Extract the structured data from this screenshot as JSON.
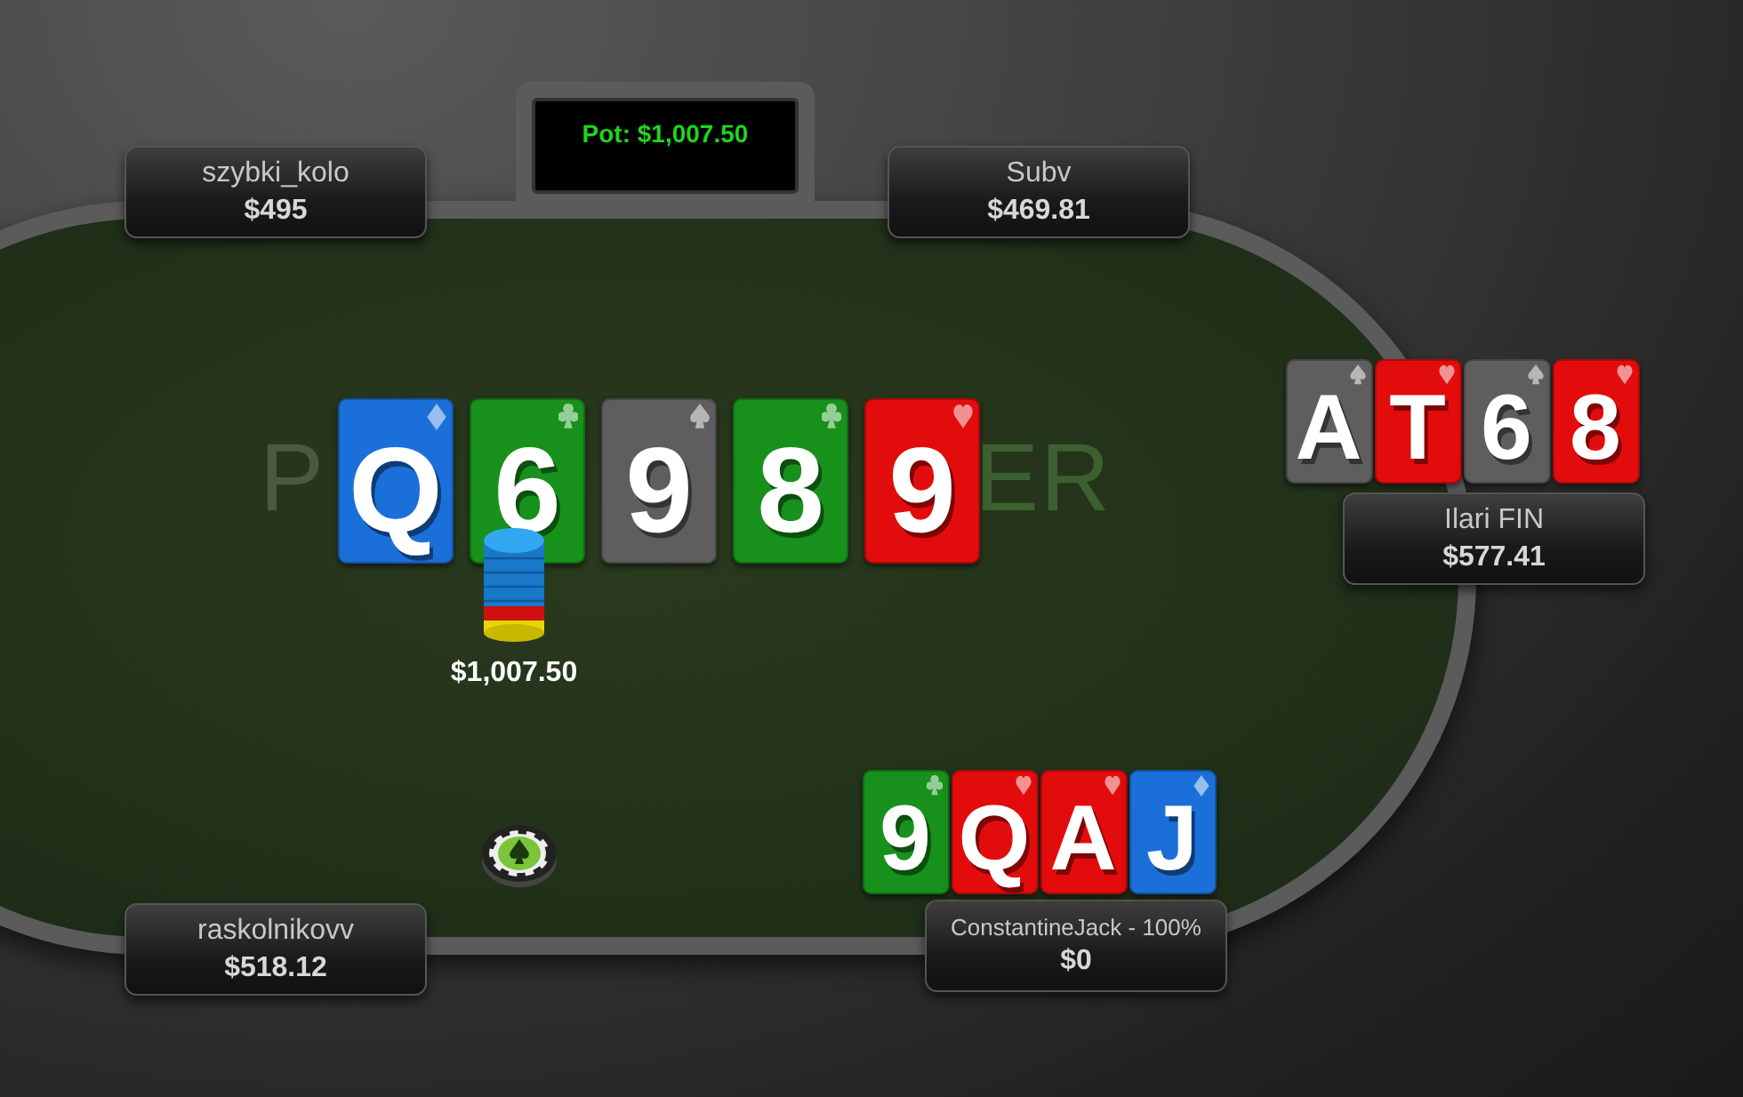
{
  "pot": {
    "label": "Pot: $1,007.50"
  },
  "felt_logo": {
    "left": "P",
    "right": "ER"
  },
  "board": [
    {
      "rank": "Q",
      "kind": "diamonds"
    },
    {
      "rank": "6",
      "kind": "clubs"
    },
    {
      "rank": "9",
      "kind": "spades"
    },
    {
      "rank": "8",
      "kind": "clubs"
    },
    {
      "rank": "9",
      "kind": "hearts"
    }
  ],
  "bet": {
    "amount": "$1,007.50"
  },
  "seats": [
    {
      "name": "szybki_kolo",
      "stack": "$495",
      "dealer": false
    },
    {
      "name": "Subv",
      "stack": "$469.81",
      "dealer": false
    },
    {
      "name": "Ilari FIN",
      "stack": "$577.41",
      "dealer": false,
      "cards": [
        {
          "rank": "A",
          "kind": "spades"
        },
        {
          "rank": "T",
          "kind": "hearts"
        },
        {
          "rank": "6",
          "kind": "spades"
        },
        {
          "rank": "8",
          "kind": "hearts"
        }
      ]
    },
    {
      "name": "raskolnikovv",
      "stack": "$518.12",
      "dealer": true
    },
    {
      "name": "ConstantineJack - 100%",
      "stack": "$0",
      "dealer": false,
      "cards": [
        {
          "rank": "9",
          "kind": "clubs"
        },
        {
          "rank": "Q",
          "kind": "hearts"
        },
        {
          "rank": "A",
          "kind": "hearts"
        },
        {
          "rank": "J",
          "kind": "diamonds"
        }
      ]
    }
  ]
}
